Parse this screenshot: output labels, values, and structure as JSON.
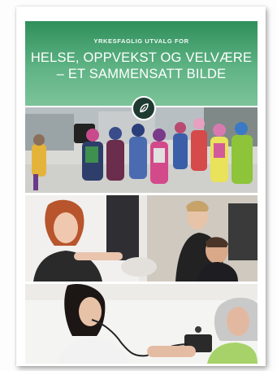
{
  "cover": {
    "kicker": "YRKESFAGLIG UTVALG FOR",
    "title_line1": "HELSE, OPPVEKST OG VELVÆRE",
    "title_line2": "– ET SAMMENSATT BILDE",
    "brand_color": "#3a9a66",
    "badge_icon": "leaf-icon"
  },
  "photos": {
    "top": "children-walking-photo",
    "middle": "hairdressing-photo",
    "bottom": "blood-pressure-photo"
  }
}
